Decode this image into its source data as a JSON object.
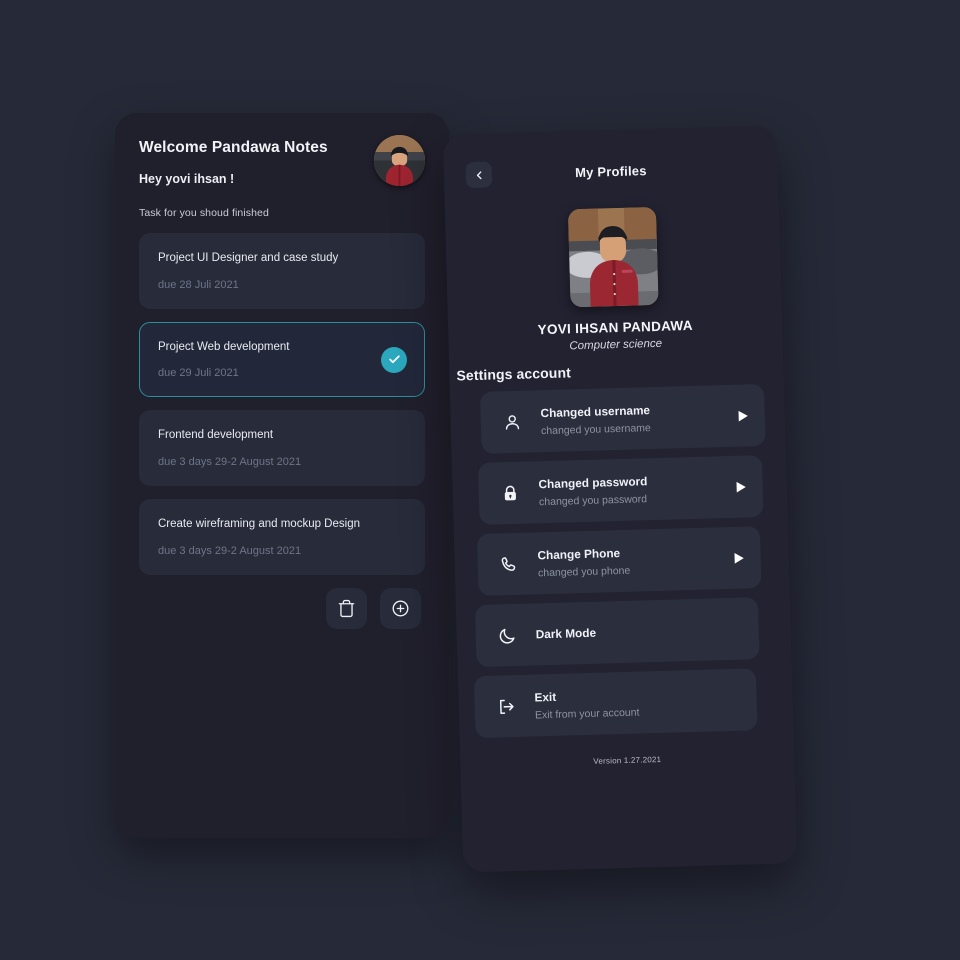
{
  "phone_notes": {
    "title": "Welcome Pandawa Notes",
    "greeting": "Hey yovi ihsan !",
    "subtitle": "Task for you shoud finished",
    "avatar_icon": "user-avatar-photo",
    "tasks": [
      {
        "title": "Project UI Designer and case study",
        "due": "due 28 Juli 2021",
        "selected": false,
        "completed": false
      },
      {
        "title": "Project Web development",
        "due": "due 29 Juli 2021",
        "selected": true,
        "completed": true
      },
      {
        "title": "Frontend development",
        "due": "due 3 days 29-2 August 2021",
        "selected": false,
        "completed": false
      },
      {
        "title": "Create wireframing and  mockup Design",
        "due": "due 3 days 29-2 August 2021",
        "selected": false,
        "completed": false
      }
    ],
    "actions": [
      {
        "icon": "trash-icon",
        "label": "Delete"
      },
      {
        "icon": "plus-circle-icon",
        "label": "Add"
      }
    ]
  },
  "phone_profile": {
    "back_icon": "chevron-left-icon",
    "title": "My Profiles",
    "photo_icon": "profile-photo",
    "name": "YOVI IHSAN PANDAWA",
    "major": "Computer science",
    "settings_heading": "Settings account",
    "settings": [
      {
        "icon": "person-icon",
        "title": "Changed username",
        "subtitle": "changed you username",
        "arrow": "play-arrow-icon"
      },
      {
        "icon": "lock-icon",
        "title": "Changed password",
        "subtitle": "changed you password",
        "arrow": "play-arrow-icon"
      },
      {
        "icon": "phone-icon",
        "title": "Change Phone",
        "subtitle": "changed you phone",
        "arrow": "play-arrow-icon"
      },
      {
        "icon": "moon-icon",
        "title": "Dark Mode",
        "subtitle": "",
        "arrow": ""
      },
      {
        "icon": "exit-icon",
        "title": "Exit",
        "subtitle": "Exit from your account",
        "arrow": ""
      }
    ],
    "version": "Version 1.27.2021"
  },
  "colors": {
    "page_background": "#262a38",
    "phone_one_background": "#201f2c",
    "phone_two_background": "#232231",
    "card": "#272b3a",
    "card_alt": "#2a2e3d",
    "accent_teal": "#2ba8be",
    "accent_border": "#2e8e9e",
    "text_primary": "#f1f2f7",
    "text_muted": "#6f7588"
  }
}
